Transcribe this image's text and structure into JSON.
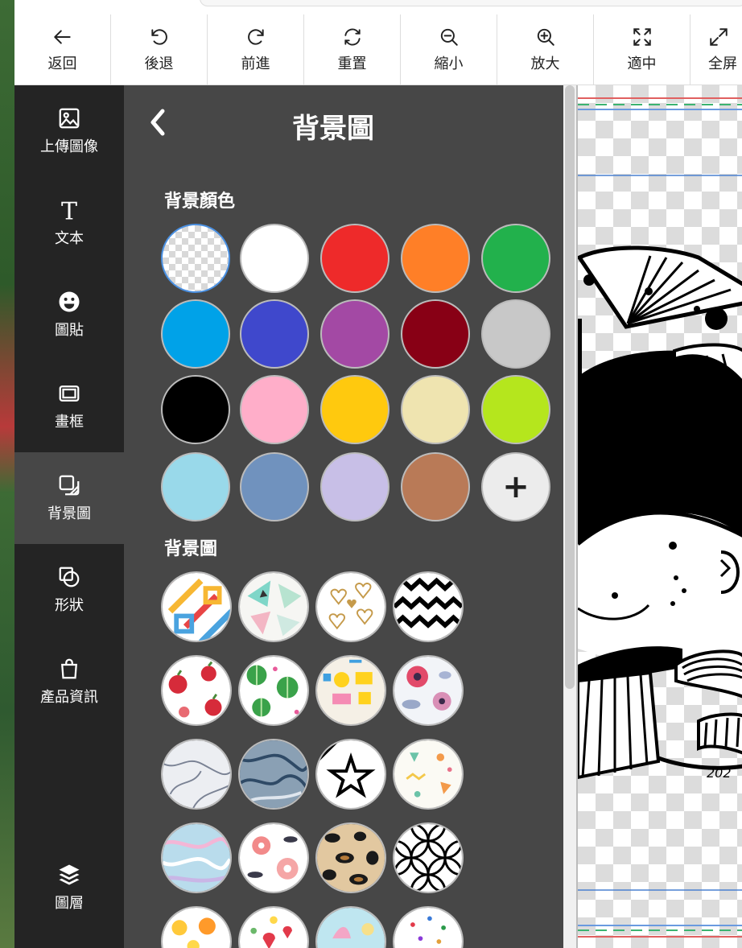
{
  "toolbar": {
    "buttons": [
      {
        "label": "返回",
        "icon": "arrow-left-icon"
      },
      {
        "label": "後退",
        "icon": "undo-icon"
      },
      {
        "label": "前進",
        "icon": "redo-icon"
      },
      {
        "label": "重置",
        "icon": "refresh-icon"
      },
      {
        "label": "縮小",
        "icon": "zoom-out-icon"
      },
      {
        "label": "放大",
        "icon": "zoom-in-icon"
      },
      {
        "label": "適中",
        "icon": "fit-icon"
      },
      {
        "label": "全屏",
        "icon": "fullscreen-icon"
      }
    ]
  },
  "sidenav": {
    "items": [
      {
        "label": "上傳圖像",
        "icon": "image-icon"
      },
      {
        "label": "文本",
        "icon": "text-icon"
      },
      {
        "label": "圖貼",
        "icon": "smiley-icon"
      },
      {
        "label": "畫框",
        "icon": "frame-icon"
      },
      {
        "label": "背景圖",
        "icon": "background-icon"
      },
      {
        "label": "形狀",
        "icon": "shape-icon"
      },
      {
        "label": "產品資訊",
        "icon": "shopping-bag-icon"
      },
      {
        "label": "圖層",
        "icon": "layers-icon"
      }
    ],
    "active": "背景圖"
  },
  "panel": {
    "title": "背景圖",
    "color_section_label": "背景顏色",
    "pattern_section_label": "背景圖",
    "colors": [
      "transparent",
      "#ffffff",
      "#ee2a2a",
      "#ff7f27",
      "#22b14c",
      "#00a2e8",
      "#3f48cc",
      "#a349a4",
      "#880015",
      "#c8c8c8",
      "#000000",
      "#ffaec9",
      "#ffc90e",
      "#efe4b0",
      "#b5e61d",
      "#99d9ea",
      "#7092be",
      "#c8bfe7",
      "#b97a57",
      "add"
    ],
    "add_symbol": "+"
  }
}
